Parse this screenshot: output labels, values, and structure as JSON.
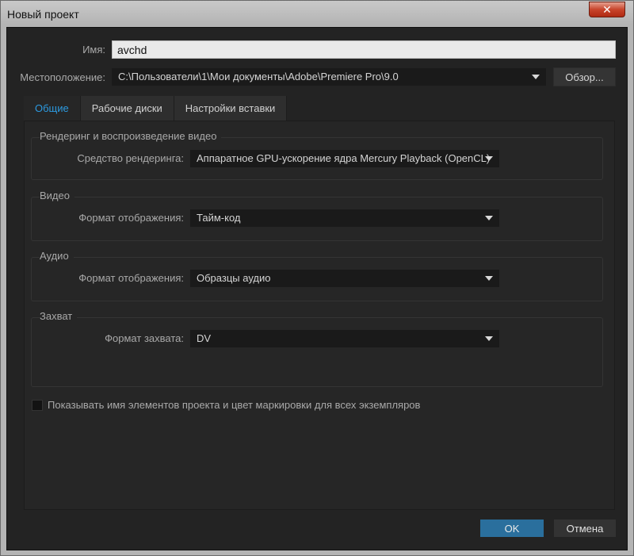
{
  "window": {
    "title": "Новый проект",
    "close_glyph": "✕"
  },
  "fields": {
    "name_label": "Имя:",
    "name_value": "avchd",
    "location_label": "Местоположение:",
    "location_value": "C:\\Пользователи\\1\\Мои документы\\Adobe\\Premiere Pro\\9.0",
    "browse_label": "Обзор..."
  },
  "tabs": [
    {
      "label": "Общие",
      "active": true
    },
    {
      "label": "Рабочие диски",
      "active": false
    },
    {
      "label": "Настройки вставки",
      "active": false
    }
  ],
  "groups": {
    "render": {
      "title": "Рендеринг и воспроизведение видео",
      "label": "Средство рендеринга:",
      "value": "Аппаратное GPU-ускорение ядра Mercury Playback (OpenCL)"
    },
    "video": {
      "title": "Видео",
      "label": "Формат отображения:",
      "value": "Тайм-код"
    },
    "audio": {
      "title": "Аудио",
      "label": "Формат отображения:",
      "value": "Образцы аудио"
    },
    "capture": {
      "title": "Захват",
      "label": "Формат захвата:",
      "value": "DV"
    }
  },
  "option": {
    "checkbox_label": "Показывать имя элементов проекта и цвет маркировки для всех экземпляров",
    "checked": false
  },
  "buttons": {
    "ok": "OK",
    "cancel": "Отмена"
  },
  "colors": {
    "accent": "#2c9ae0",
    "ok_button": "#2a6f9d",
    "close_button": "#c8442b"
  },
  "icons": {
    "dropdown": "chevron-down-icon",
    "close": "close-icon"
  }
}
